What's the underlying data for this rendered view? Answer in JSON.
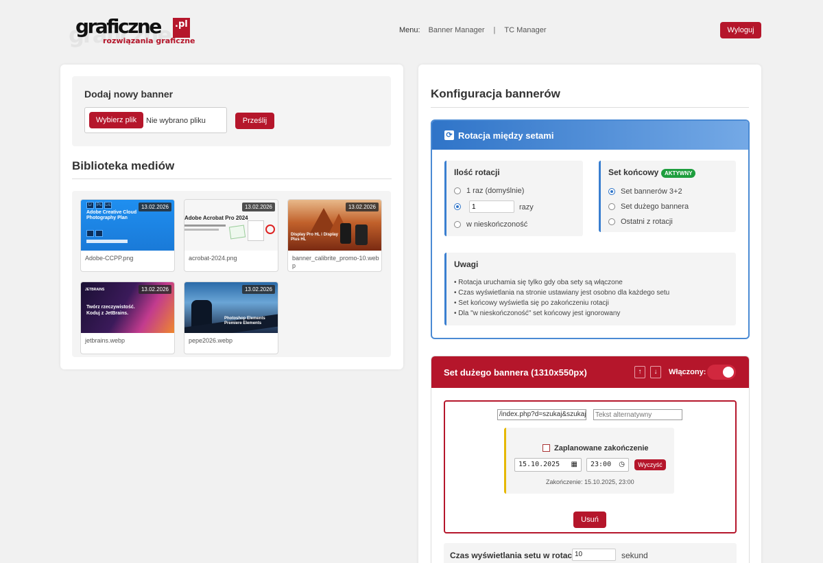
{
  "header": {
    "logo_text": "graficzne",
    "logo_tld": ".pl",
    "logo_tagline": "rozwiązania graficzne",
    "menu_label": "Menu:",
    "menu_items": [
      "Banner Manager",
      "TC Manager"
    ],
    "menu_separator": "|",
    "logout_label": "Wyloguj"
  },
  "upload": {
    "title": "Dodaj nowy banner",
    "choose_label": "Wybierz plik",
    "no_file_label": "Nie wybrano pliku",
    "submit_label": "Prześlij"
  },
  "library": {
    "title": "Biblioteka mediów",
    "items": [
      {
        "filename": "Adobe-CCPP.png",
        "date": "13.02.2026",
        "thumb_caption": "Adobe Creative Cloud Photography Plan"
      },
      {
        "filename": "acrobat-2024.png",
        "date": "13.02.2026",
        "thumb_caption": "Adobe Acrobat Pro 2024"
      },
      {
        "filename": "banner_calibrite_promo-10.webp",
        "date": "13.02.2026",
        "thumb_caption": "Display Pro HL i Display Plus HL"
      },
      {
        "filename": "jetbrains.webp",
        "date": "13.02.2026",
        "thumb_caption": "Twórz rzeczywistość. Koduj z JetBrains."
      },
      {
        "filename": "pepe2026.webp",
        "date": "13.02.2026",
        "thumb_caption": "Photoshop Elements Premiere Elements"
      }
    ]
  },
  "config": {
    "title": "Konfiguracja bannerów",
    "rotation": {
      "title": "Rotacja między setami",
      "count": {
        "title": "Ilość rotacji",
        "option_once": "1 raz (domyślnie)",
        "option_custom_value": "1",
        "option_custom_unit": "razy",
        "option_infinite": "w nieskończoność",
        "selected": "custom"
      },
      "final_set": {
        "title": "Set końcowy",
        "badge": "AKTYWNY",
        "options": [
          "Set bannerów 3+2",
          "Set dużego bannera",
          "Ostatni z rotacji"
        ],
        "selected_index": 0
      },
      "notes": {
        "title": "Uwagi",
        "items": [
          "• Rotacja uruchamia się tylko gdy oba sety są włączone",
          "• Czas wyświetlania na stronie ustawiany jest osobno dla każdego setu",
          "• Set końcowy wyświetla się po zakończeniu rotacji",
          "• Dla \"w nieskończoność\" set końcowy jest ignorowany"
        ]
      }
    },
    "big_banner": {
      "title": "Set dużego bannera (1310x550px)",
      "up_label": "↑",
      "down_label": "↓",
      "toggle_label": "Włączony:",
      "enabled": true,
      "link_value": "/index.php?d=szukaj&szukaj",
      "alt_placeholder": "Tekst alternatywny",
      "schedule": {
        "title": "Zaplanowane zakończenie",
        "date": "15.10.2025",
        "time": "23:00",
        "clear_label": "Wyczyść",
        "end_text": "Zakończenie: 15.10.2025, 23:00"
      },
      "delete_label": "Usuń",
      "display_time_label": "Czas wyświetlania setu w rotacji:",
      "display_time_value": "10",
      "display_time_unit": "sekund"
    }
  },
  "colors": {
    "accent_red": "#b5162b",
    "accent_blue": "#2f74c8",
    "badge_green": "#1e9e3e",
    "schedule_yellow": "#e6b800"
  }
}
